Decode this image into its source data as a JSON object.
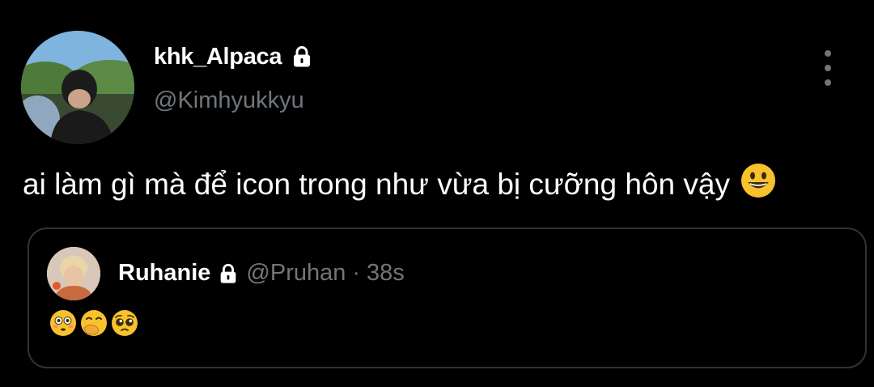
{
  "author": {
    "display_name": "khk_Alpaca",
    "handle": "@Kimhyukkyu",
    "protected_icon": "lock-icon",
    "avatar": "profile-photo"
  },
  "tweet": {
    "text": "ai làm gì mà để icon trong như vừa bị cưỡng hôn vậy",
    "trailing_emoji": "grinning-face"
  },
  "more_menu_icon": "more-vertical-icon",
  "quoted_tweet": {
    "display_name": "Ruhanie",
    "handle": "@Pruhan",
    "separator": "·",
    "time": "38s",
    "protected_icon": "lock-icon",
    "emojis": [
      "flushed-face",
      "face-with-hand-over-mouth",
      "pleading-face"
    ]
  },
  "colors": {
    "background": "#000000",
    "text_primary": "#ffffff",
    "text_secondary": "#71767b",
    "border": "#2f3336",
    "emoji_yellow": "#f7c22c"
  }
}
